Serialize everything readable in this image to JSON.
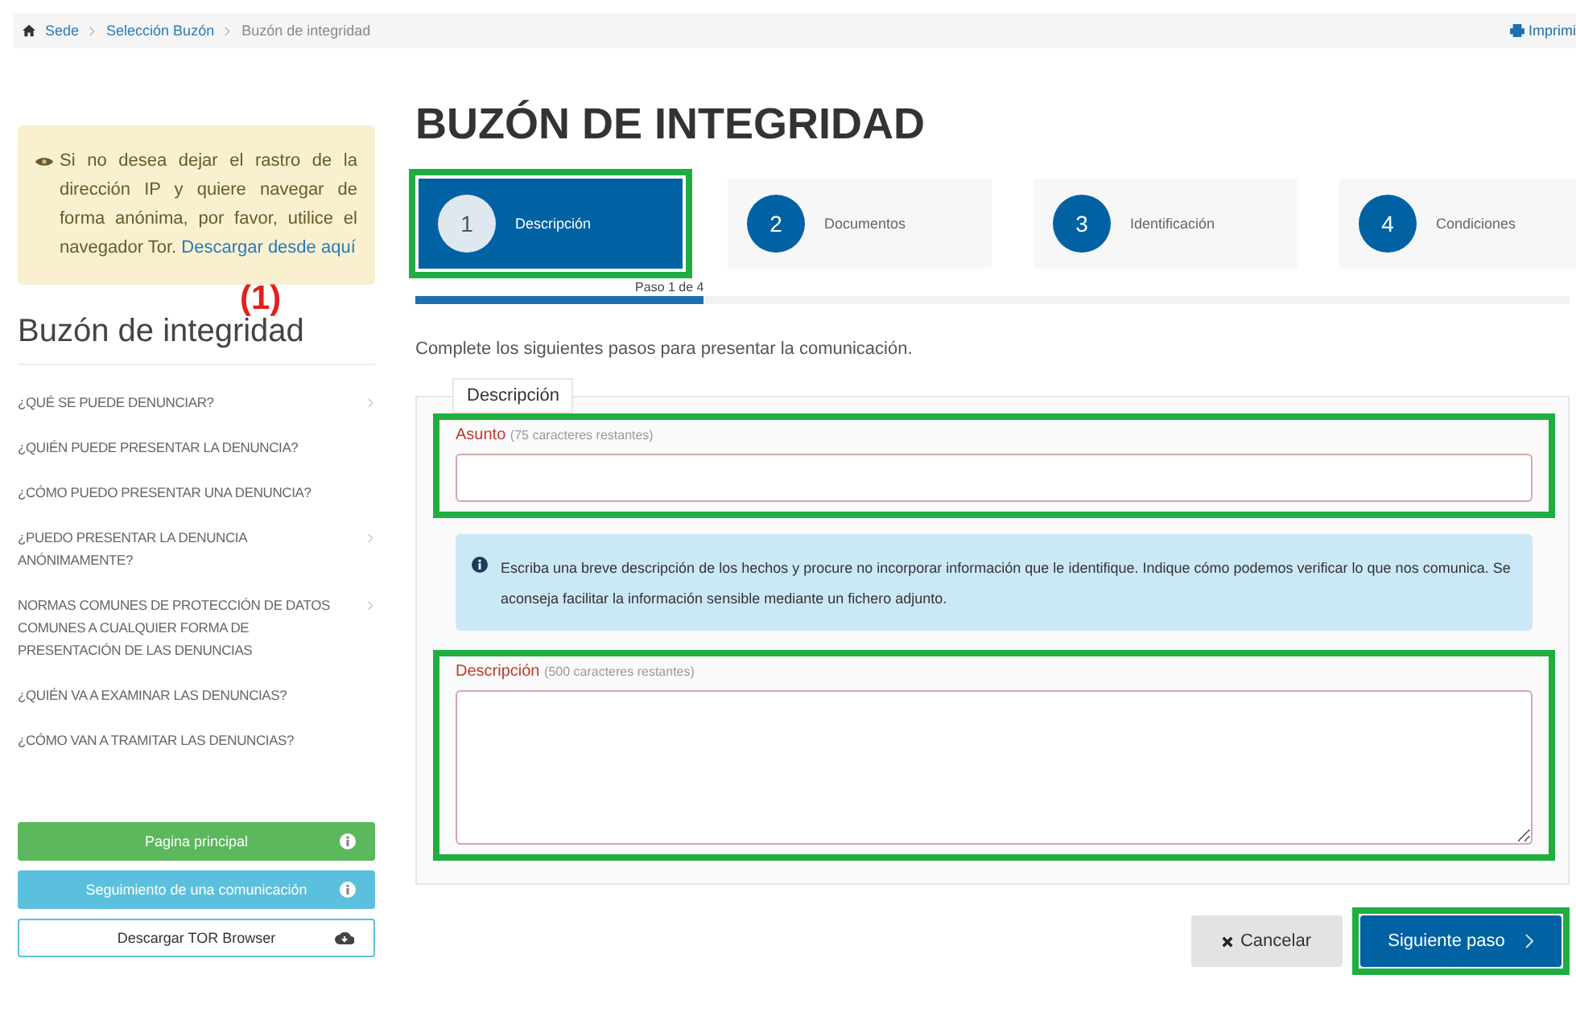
{
  "breadcrumb": {
    "items": [
      {
        "label": "Sede",
        "link": true
      },
      {
        "label": "Selección Buzón",
        "link": true
      },
      {
        "label": "Buzón de integridad",
        "link": false
      }
    ],
    "print_link": "Imprimi"
  },
  "sidebar": {
    "notice": {
      "text": "Si no desea dejar el rastro de la dirección IP y quiere navegar de forma anónima, por favor, utilice el navegador Tor.",
      "link": "Descargar desde aquí"
    },
    "annotation": "(1)",
    "title": "Buzón de integridad",
    "items": [
      {
        "label": "¿QUÉ SE PUEDE DENUNCIAR?",
        "expandable": true
      },
      {
        "label": "¿QUIÉN PUEDE PRESENTAR LA DENUNCIA?",
        "expandable": false
      },
      {
        "label": "¿CÓMO PUEDO PRESENTAR UNA DENUNCIA?",
        "expandable": false
      },
      {
        "label": "¿PUEDO PRESENTAR LA DENUNCIA ANÓNIMAMENTE?",
        "expandable": true
      },
      {
        "label": "NORMAS COMUNES DE PROTECCIÓN DE DATOS COMUNES A CUALQUIER FORMA DE PRESENTACIÓN DE LAS DENUNCIAS",
        "expandable": true
      },
      {
        "label": "¿QUIÉN VA A EXAMINAR LAS DENUNCIAS?",
        "expandable": false
      },
      {
        "label": "¿CÓMO VAN A TRAMITAR LAS DENUNCIAS?",
        "expandable": false
      }
    ],
    "buttons": [
      {
        "label": "Pagina principal",
        "kind": "info",
        "color": "#5cb85c"
      },
      {
        "label": "Seguimiento de una comunicación",
        "kind": "info",
        "color": "#5bc0de"
      },
      {
        "label": "Descargar TOR Browser",
        "kind": "download",
        "color": "#ffffff"
      }
    ]
  },
  "main": {
    "title": "BUZÓN DE INTEGRIDAD",
    "steps": [
      {
        "number": "1",
        "label": "Descripción",
        "selected": true,
        "highlighted": true
      },
      {
        "number": "2",
        "label": "Documentos",
        "selected": false,
        "highlighted": false
      },
      {
        "number": "3",
        "label": "Identificación",
        "selected": false,
        "highlighted": false
      },
      {
        "number": "4",
        "label": "Condiciones",
        "selected": false,
        "highlighted": false
      }
    ],
    "progress": {
      "label": "Paso 1 de 4",
      "level": 0.25
    },
    "intro": "Complete los siguientes pasos para presentar la comunicación.",
    "fieldset": {
      "legend": "Descripción",
      "subject": {
        "label": "Asunto",
        "hint": "(75 caracteres restantes)",
        "highlighted": true
      },
      "info": "Escriba una breve descripción de los hechos y procure no incorporar información que le identifique. Indique cómo podemos verificar lo que nos comunica. Se aconseja facilitar la información sensible mediante un fichero adjunto.",
      "description": {
        "label": "Descripción",
        "hint": "(500 caracteres restantes)",
        "highlighted": true
      }
    },
    "actions": {
      "cancel": "Cancelar",
      "next": "Siguiente paso",
      "next_highlighted": true
    }
  }
}
